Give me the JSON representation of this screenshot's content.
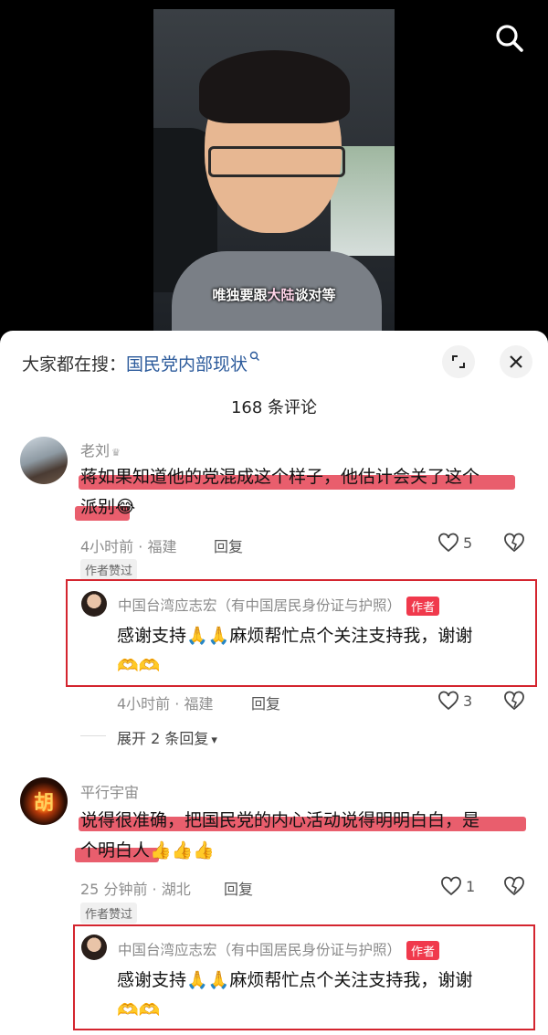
{
  "video": {
    "subtitle_pre": "唯独要跟",
    "subtitle_hl": "大陆",
    "subtitle_post": "谈对等"
  },
  "sheet": {
    "search_prefix": "大家都在搜：",
    "search_keyword": "国民党内部现状",
    "comment_count": "168 条评论"
  },
  "comments": [
    {
      "user": "老刘",
      "text_line1": "蒋如果知道他的党混成这个样子，他估计会关了这个",
      "text_line2": "派别",
      "emoji": "😂",
      "meta": "4小时前 · 福建",
      "reply_label": "回复",
      "likes": "5",
      "tag": "作者赞过",
      "author_reply": {
        "user": "中国台湾应志宏（有中国居民身份证与护照）",
        "badge": "作者",
        "text": "感谢支持🙏🙏麻烦帮忙点个关注支持我，谢谢",
        "emoji_line2": "🫶🫶",
        "meta": "4小时前 · 福建",
        "reply_label": "回复",
        "likes": "3"
      },
      "expand": "展开 2 条回复"
    },
    {
      "user": "平行宇宙",
      "text_line1": "说得很准确，把国民党的内心活动说得明明白白，是",
      "text_line2": "个明白人",
      "emoji": "👍👍👍",
      "meta": "25 分钟前 · 湖北",
      "reply_label": "回复",
      "likes": "1",
      "tag": "作者赞过",
      "author_reply": {
        "user": "中国台湾应志宏（有中国居民身份证与护照）",
        "badge": "作者",
        "text": "感谢支持🙏🙏麻烦帮忙点个关注支持我，谢谢",
        "emoji_line2": "🫶🫶"
      }
    }
  ],
  "colors": {
    "highlight": "#e1283c",
    "box": "#d4252f",
    "link": "#2b5a9b",
    "badge": "#f0394c"
  }
}
